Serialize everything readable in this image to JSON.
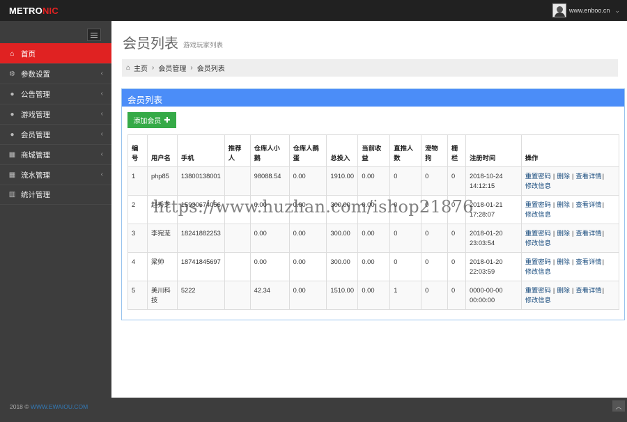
{
  "header": {
    "logo_main": "METRO",
    "logo_accent": "NIC",
    "username": "www.enboo.cn"
  },
  "sidebar": {
    "items": [
      {
        "label": "首页",
        "icon": "home-icon",
        "glyph": "⌂",
        "active": true
      },
      {
        "label": "参数设置",
        "icon": "cogs-icon",
        "glyph": "⚙",
        "active": false
      },
      {
        "label": "公告管理",
        "icon": "user-icon",
        "glyph": "●",
        "active": false
      },
      {
        "label": "游戏管理",
        "icon": "user-icon",
        "glyph": "●",
        "active": false
      },
      {
        "label": "会员管理",
        "icon": "user-icon",
        "glyph": "●",
        "active": false
      },
      {
        "label": "商城管理",
        "icon": "table-icon",
        "glyph": "▦",
        "active": false
      },
      {
        "label": "流水管理",
        "icon": "table-icon",
        "glyph": "▦",
        "active": false
      },
      {
        "label": "统计管理",
        "icon": "bar-chart-icon",
        "glyph": "▥",
        "active": false
      }
    ]
  },
  "page": {
    "title": "会员列表",
    "subtitle": "游戏玩家列表"
  },
  "breadcrumb": [
    "主页",
    "会员管理",
    "会员列表"
  ],
  "portlet": {
    "title": "会员列表",
    "add_button": "添加会员"
  },
  "table": {
    "headers": [
      "编号",
      "用户名",
      "手机",
      "推荐人",
      "仓库人小鹅",
      "仓库人鹅蛋",
      "总投入",
      "当前收益",
      "直推人数",
      "宠物狗",
      "栅栏",
      "注册时间",
      "操作"
    ],
    "rows": [
      [
        "1",
        "php85",
        "13800138001",
        "",
        "98088.54",
        "0.00",
        "1910.00",
        "0.00",
        "0",
        "0",
        "0",
        "2018-10-24 14:12:15"
      ],
      [
        "2",
        "赵秀芝",
        "15930674056",
        "",
        "0.00",
        "0.00",
        "300.00",
        "0.00",
        "0",
        "0",
        "0",
        "2018-01-21 17:28:07"
      ],
      [
        "3",
        "李宛茏",
        "18241882253",
        "",
        "0.00",
        "0.00",
        "300.00",
        "0.00",
        "0",
        "0",
        "0",
        "2018-01-20 23:03:54"
      ],
      [
        "4",
        "梁帅",
        "18741845697",
        "",
        "0.00",
        "0.00",
        "300.00",
        "0.00",
        "0",
        "0",
        "0",
        "2018-01-20 22:03:59"
      ],
      [
        "5",
        "美川科技",
        "5222",
        "",
        "42.34",
        "0.00",
        "1510.00",
        "0.00",
        "1",
        "0",
        "0",
        "0000-00-00 00:00:00"
      ]
    ],
    "actions": {
      "reset": "重置密码",
      "delete": "删除",
      "view": "查看详情",
      "edit": "修改信息"
    }
  },
  "footer": {
    "year": "2018 ©",
    "site": "WWW.EWAIOU.COM"
  },
  "watermark": "https://www.huzhan.com/ishop21876"
}
